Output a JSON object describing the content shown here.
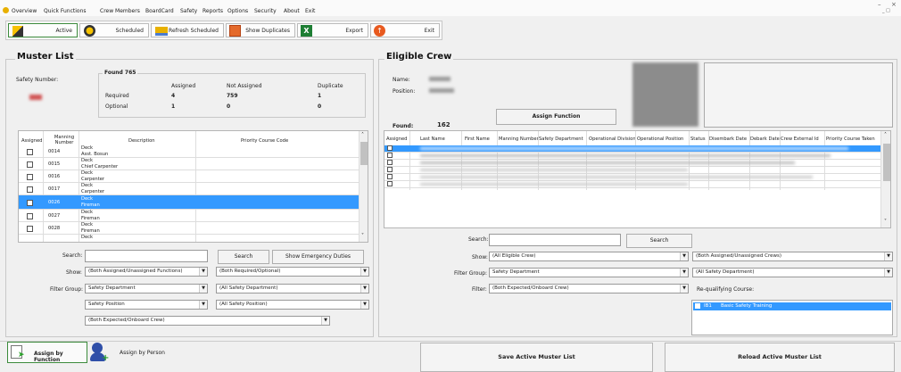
{
  "menu": {
    "items": [
      "Overview",
      "Quick Functions",
      "Crew Members",
      "BoardCard",
      "Safety",
      "Reports",
      "Options",
      "Security",
      "About",
      "Exit"
    ]
  },
  "toolbar": {
    "active_label": "Active",
    "scheduled_label": "Scheduled",
    "refresh_label": "Refresh Scheduled",
    "duplicates_label": "Show Duplicates",
    "export_label": "Export",
    "exit_label": "Exit"
  },
  "muster": {
    "title": "Muster List",
    "safety_number_label": "Safety Number:",
    "found_label": "Found 765",
    "col_assigned": "Assigned",
    "col_not_assigned": "Not Assigned",
    "col_duplicate": "Duplicate",
    "required_label": "Required",
    "optional_label": "Optional",
    "required": {
      "assigned": "4",
      "not_assigned": "759",
      "duplicate": "1"
    },
    "optional": {
      "assigned": "1",
      "not_assigned": "0",
      "duplicate": "0"
    },
    "grid_headers": {
      "assigned": "Assigned",
      "manning": "Manning Number",
      "description": "Description",
      "priority": "Priority Course Code"
    },
    "rows": [
      {
        "num": "0014",
        "desc1": "Deck",
        "desc2": "Asst. Bosun",
        "selected": false
      },
      {
        "num": "0015",
        "desc1": "Deck",
        "desc2": "Chief Carpenter",
        "selected": false
      },
      {
        "num": "0016",
        "desc1": "Deck",
        "desc2": "Carpenter",
        "selected": false
      },
      {
        "num": "0017",
        "desc1": "Deck",
        "desc2": "Carpenter",
        "selected": false
      },
      {
        "num": "0026",
        "desc1": "Deck",
        "desc2": "Fireman",
        "selected": true
      },
      {
        "num": "0027",
        "desc1": "Deck",
        "desc2": "Fireman",
        "selected": false
      },
      {
        "num": "0028",
        "desc1": "Deck",
        "desc2": "Fireman",
        "selected": false
      },
      {
        "num": "",
        "desc1": "Deck",
        "desc2": "",
        "selected": false
      }
    ],
    "search_label": "Search:",
    "search_button": "Search",
    "emergency_button": "Show Emergency Duties",
    "show_label": "Show:",
    "show_value": "(Both Assigned/Unassigned Functions)",
    "required_filter_value": "(Both Required/Optional)",
    "filter_group_label": "Filter Group:",
    "filter_group_value": "Safety Department",
    "all_safety_dept_value": "(All Safety Department)",
    "safety_position_value": "Safety Position",
    "all_safety_position_value": "(All Safety Position)",
    "expected_onboard_value": "(Both Expected/Onboard Crew)"
  },
  "eligible": {
    "title": "Eligible Crew",
    "name_label": "Name:",
    "position_label": "Position:",
    "found_label": "Found:",
    "found_value": "162",
    "assign_function_button": "Assign Function",
    "grid_headers": [
      "Assigned",
      "Last Name",
      "First Name",
      "Manning Number",
      "Safety Department",
      "Operational Division",
      "Operational Position",
      "Status",
      "Disembark Date",
      "Debark Date",
      "Crew External Id",
      "Priority Course Taken"
    ],
    "search_label": "Search:",
    "search_button": "Search",
    "show_label": "Show:",
    "show_value": "(All Eligible Crew)",
    "assigned_crews_value": "(Both Assigned/Unassigned Crews)",
    "filter_group_label": "Filter Group:",
    "filter_group_value": "Safety Department",
    "all_safety_dept_value": "(All Safety Department)",
    "filter_label": "Filter:",
    "filter_value": "(Both Expected/Onboard Crew)",
    "requalifying_label": "Re-qualifying Course:",
    "course_code": "IB1",
    "course_name": "Basic Safety Training"
  },
  "bottom": {
    "assign_by_function": "Assign by Function",
    "assign_by_person": "Assign by Person",
    "save_button": "Save Active Muster List",
    "reload_button": "Reload Active Muster List"
  },
  "colors": {
    "selection": "#3399ff",
    "active_border": "#3c8b3c"
  }
}
